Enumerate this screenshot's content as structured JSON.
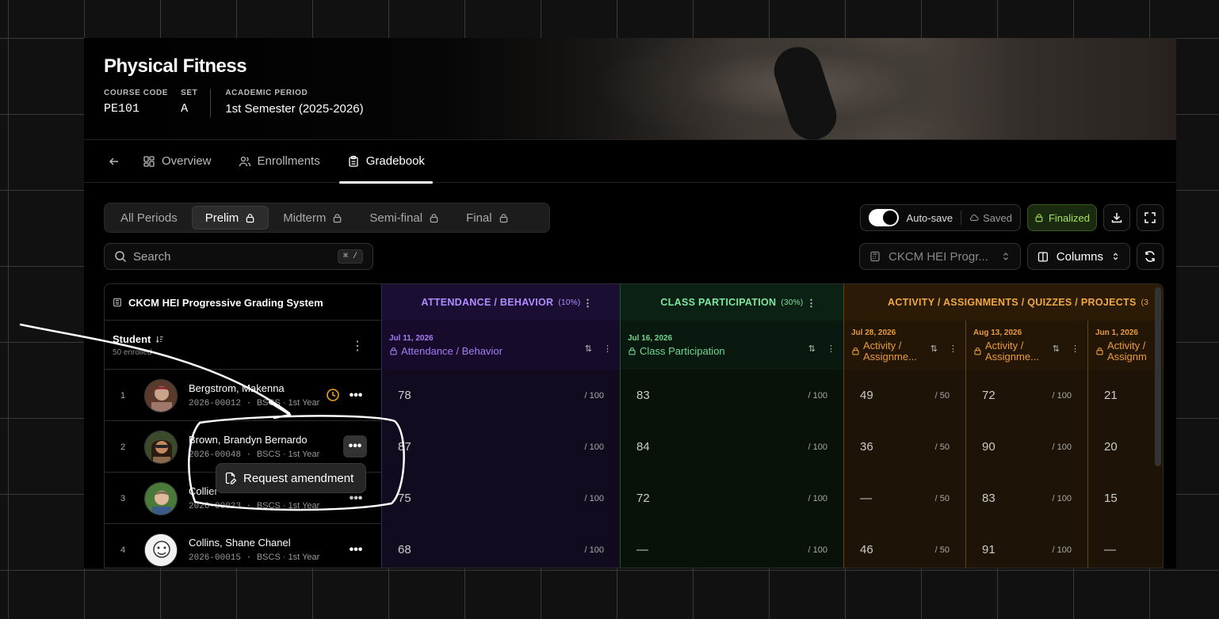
{
  "course": {
    "title": "Physical Fitness",
    "code_label": "COURSE CODE",
    "code": "PE101",
    "set_label": "SET",
    "set": "A",
    "period_label": "ACADEMIC PERIOD",
    "period": "1st Semester (2025-2026)"
  },
  "tabs": [
    {
      "label": "Overview"
    },
    {
      "label": "Enrollments"
    },
    {
      "label": "Gradebook"
    }
  ],
  "periods": [
    "All Periods",
    "Prelim",
    "Midterm",
    "Semi-final",
    "Final"
  ],
  "toolbar": {
    "autosave": "Auto-save",
    "saved": "Saved",
    "finalized": "Finalized",
    "search_placeholder": "Search",
    "search_kbd": "⌘ /",
    "grading_system_select": "CKCM HEI Progr...",
    "columns": "Columns"
  },
  "table": {
    "system": "CKCM HEI Progressive Grading System",
    "groups": {
      "attendance": {
        "name": "ATTENDANCE / BEHAVIOR",
        "pct": "(10%)"
      },
      "participation": {
        "name": "CLASS PARTICIPATION",
        "pct": "(30%)"
      },
      "activity": {
        "name": "ACTIVITY / ASSIGNMENTS / QUIZZES / PROJECTS",
        "pct": "(3"
      }
    },
    "student_col": {
      "title": "Student",
      "sub": "50 enrolled"
    },
    "subcols": {
      "att": {
        "date": "Jul 11, 2026",
        "name": "Attendance / Behavior"
      },
      "cp": {
        "date": "Jul 16, 2026",
        "name": "Class Participation"
      },
      "a1": {
        "date": "Jul 28, 2026",
        "name1": "Activity /",
        "name2": "Assignme..."
      },
      "a2": {
        "date": "Aug 13, 2026",
        "name1": "Activity /",
        "name2": "Assignme..."
      },
      "a3": {
        "date": "Jun 1, 2026",
        "name1": "Activity /",
        "name2": "Assignm"
      }
    },
    "rows": [
      {
        "num": "1",
        "name": "Bergstrom, Makenna",
        "id": "2026-00012",
        "program": "BSCS · 1st Year",
        "att": "78",
        "att_max": "/ 100",
        "cp": "83",
        "cp_max": "/ 100",
        "a1": "49",
        "a1_max": "/ 50",
        "a2": "72",
        "a2_max": "/ 100",
        "a3": "21"
      },
      {
        "num": "2",
        "name": "Brown, Brandyn Bernardo",
        "id": "2026-00048",
        "program": "BSCS · 1st Year",
        "att": "87",
        "att_max": "/ 100",
        "cp": "84",
        "cp_max": "/ 100",
        "a1": "36",
        "a1_max": "/ 50",
        "a2": "90",
        "a2_max": "/ 100",
        "a3": "20"
      },
      {
        "num": "3",
        "name": "Collier",
        "id": "2026-00023",
        "program": "BSCS · 1st Year",
        "att": "75",
        "att_max": "/ 100",
        "cp": "72",
        "cp_max": "/ 100",
        "a1": "—",
        "a1_max": "/ 50",
        "a2": "83",
        "a2_max": "/ 100",
        "a3": "15"
      },
      {
        "num": "4",
        "name": "Collins, Shane Chanel",
        "id": "2026-00015",
        "program": "BSCS · 1st Year",
        "att": "68",
        "att_max": "/ 100",
        "cp": "—",
        "cp_max": "/ 100",
        "a1": "46",
        "a1_max": "/ 50",
        "a2": "91",
        "a2_max": "/ 100",
        "a3": "—"
      }
    ]
  },
  "popup": {
    "label": "Request amendment"
  },
  "colors": {
    "attendance": "#b18cff",
    "participation": "#7fe6a0",
    "activity": "#f0a843",
    "finalized": "#a6e05a"
  }
}
